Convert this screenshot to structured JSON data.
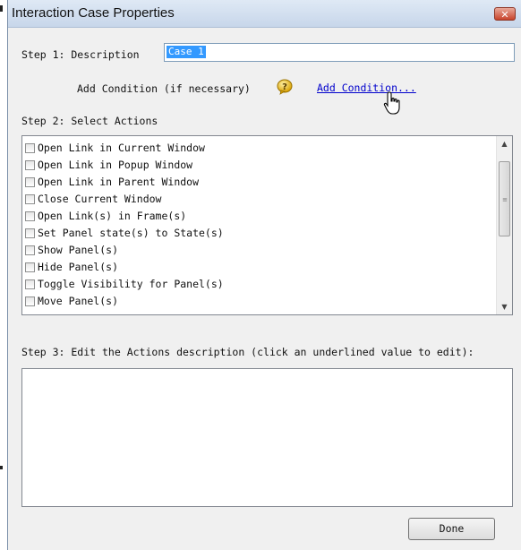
{
  "window": {
    "title": "Interaction Case Properties",
    "close_glyph": "✕"
  },
  "step1": {
    "label": "Step 1: Description",
    "description_value": "Case 1",
    "add_condition_label": "Add Condition (if necessary)",
    "add_condition_link": "Add Condition...",
    "condition_icon": "question-bubble-icon"
  },
  "step2": {
    "label": "Step 2: Select Actions",
    "actions": [
      {
        "label": "Open Link in Current Window",
        "checked": false
      },
      {
        "label": "Open Link in Popup Window",
        "checked": false
      },
      {
        "label": "Open Link in Parent Window",
        "checked": false
      },
      {
        "label": "Close Current Window",
        "checked": false
      },
      {
        "label": "Open Link(s) in Frame(s)",
        "checked": false
      },
      {
        "label": "Set Panel state(s) to State(s)",
        "checked": false
      },
      {
        "label": "Show Panel(s)",
        "checked": false
      },
      {
        "label": "Hide Panel(s)",
        "checked": false
      },
      {
        "label": "Toggle Visibility for Panel(s)",
        "checked": false
      },
      {
        "label": "Move Panel(s)",
        "checked": false
      }
    ]
  },
  "step3": {
    "label": "Step 3: Edit the Actions description (click an underlined value to edit):",
    "content": ""
  },
  "footer": {
    "done_label": "Done"
  },
  "colors": {
    "link": "#0000cc",
    "selection": "#3399ff",
    "close_button": "#c8432b"
  }
}
